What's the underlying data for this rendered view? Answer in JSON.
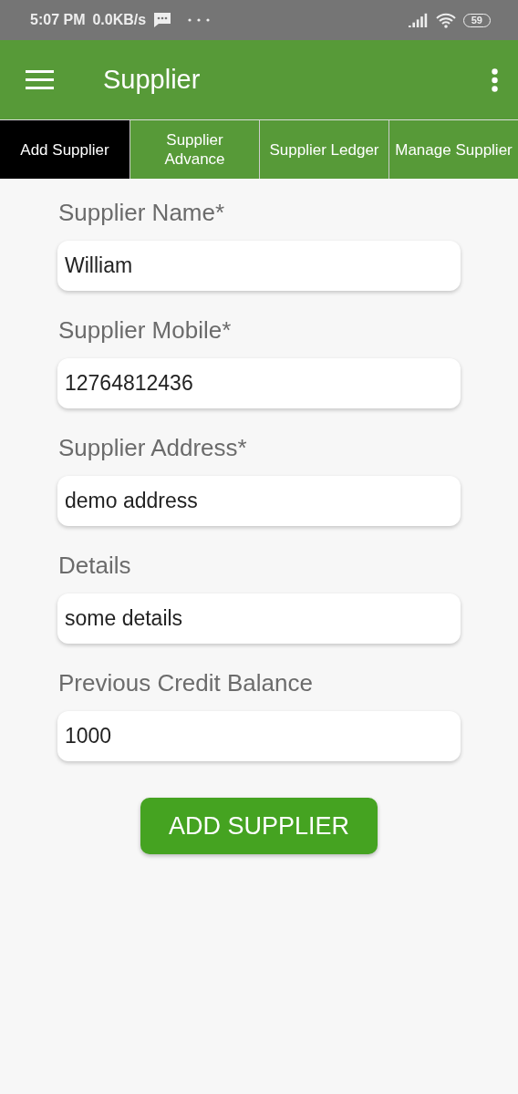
{
  "status_bar": {
    "time": "5:07 PM",
    "speed": "0.0KB/s",
    "battery": "59"
  },
  "app_bar": {
    "title": "Supplier"
  },
  "tabs": [
    {
      "label": "Add Supplier",
      "selected": true
    },
    {
      "label": "Supplier Advance",
      "selected": false
    },
    {
      "label": "Supplier Ledger",
      "selected": false
    },
    {
      "label": "Manage Supplier",
      "selected": false
    }
  ],
  "form": {
    "fields": [
      {
        "label": "Supplier Name*",
        "value": "William"
      },
      {
        "label": "Supplier Mobile*",
        "value": "12764812436"
      },
      {
        "label": "Supplier Address*",
        "value": "demo address"
      },
      {
        "label": "Details",
        "value": "some details"
      },
      {
        "label": "Previous Credit Balance",
        "value": "1000"
      }
    ],
    "submit": "ADD SUPPLIER"
  }
}
